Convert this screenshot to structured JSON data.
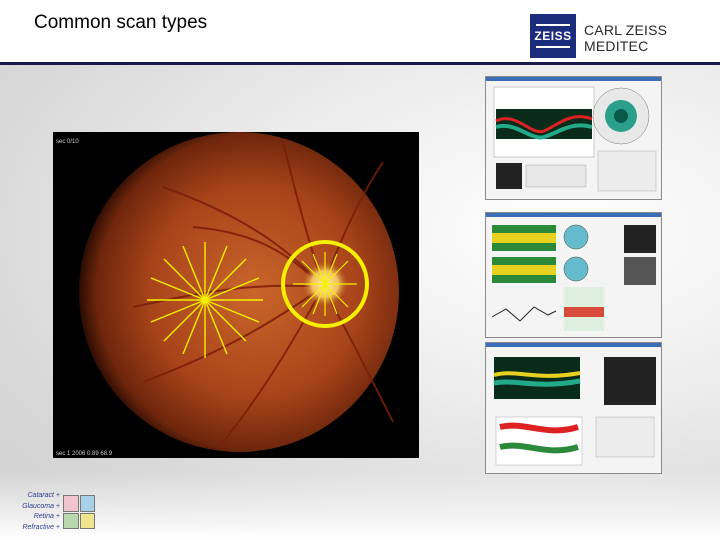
{
  "header": {
    "title": "Common scan types",
    "logo_text": "ZEISS",
    "company_name": "CARL ZEISS MEDITEC"
  },
  "fundus": {
    "overlay_top": "sec 0/10",
    "overlay_bottom": "sec 1 2006 0.89 68.9"
  },
  "legend": {
    "items": [
      "Cataract",
      "Glaucoma",
      "Retina",
      "Refractive"
    ],
    "suffix": " +",
    "colors": [
      "#f2c4d0",
      "#a8d0e8",
      "#b8d8b0",
      "#f0e48c"
    ]
  },
  "colors": {
    "header_rule": "#1a1a4a",
    "brand_blue": "#1c2c7c",
    "scan_yellow": "#f5f000"
  }
}
